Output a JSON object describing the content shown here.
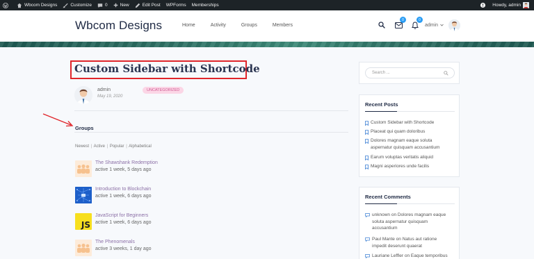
{
  "admin_bar": {
    "site_name": "Wbcom Designs",
    "customize": "Customize",
    "comments_count": "0",
    "new_label": "New",
    "edit_post": "Edit Post",
    "wpforms": "WPForms",
    "memberships": "Memberships",
    "howdy": "Howdy, admin"
  },
  "header": {
    "site_title": "Wbcom Designs",
    "nav": [
      "Home",
      "Activity",
      "Groups",
      "Members"
    ],
    "messages_count": "0",
    "notifications_count": "0",
    "user_label": "admin"
  },
  "post": {
    "title": "Custom Sidebar with Shortcode",
    "author": "admin",
    "date": "May 19, 2020",
    "category": "UNCATEGORIZED"
  },
  "groups": {
    "heading": "Groups",
    "filters": [
      "Newest",
      "Active",
      "Popular",
      "Alphabetical"
    ],
    "items": [
      {
        "name": "The Shawshank Redemption",
        "activity": "active 1 week, 5 days ago",
        "icon": "group-placeholder-icon"
      },
      {
        "name": "Introduction to Blockchain",
        "activity": "active 1 week, 6 days ago",
        "icon": "blockchain-icon"
      },
      {
        "name": "JavaScript for Beginners",
        "activity": "active 1 week, 6 days ago",
        "icon": "js-logo-icon",
        "logo_text": "JS"
      },
      {
        "name": "The Phenomenals",
        "activity": "active 3 weeks, 1 day ago",
        "icon": "group-placeholder-icon"
      }
    ]
  },
  "sidebar": {
    "search_placeholder": "Search ...",
    "recent_posts_title": "Recent Posts",
    "recent_posts": [
      "Custom Sidebar with Shortcode",
      "Placeat qui quam doloribus",
      [
        "Dolores magnam eaque soluta",
        "aspernatur quisquam accusantium"
      ],
      "Earum voluptas veritatis aliquid",
      "Magni asperiores unde facilis"
    ],
    "recent_comments_title": "Recent Comments",
    "recent_comments": [
      [
        "unknown on Dolores magnam eaque",
        "soluta aspernatur quisquam",
        "accusantium"
      ],
      [
        "Paul Mante on Natus aut ratione",
        "impedit deserunt quaerat"
      ],
      [
        "Lauriane Leffler on Eaque temporibus"
      ]
    ]
  },
  "colors": {
    "accent": "#2a9df4",
    "title_text": "#2a3450",
    "highlight_box": "#e0252a",
    "group_link": "#8b6fa6",
    "category_bg": "#fbd6e6"
  }
}
